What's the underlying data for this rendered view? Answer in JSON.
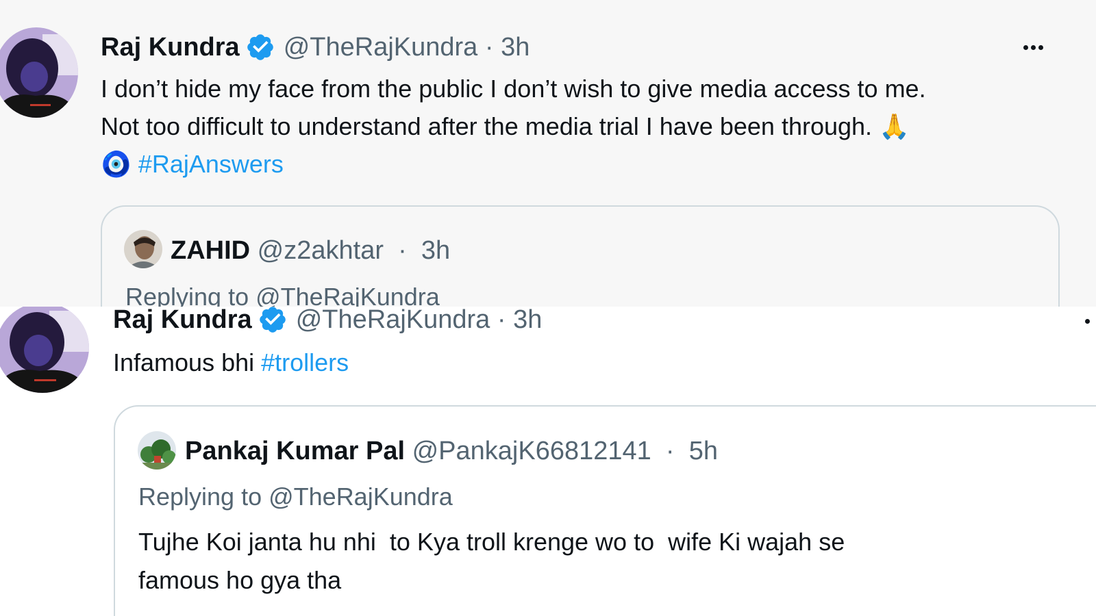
{
  "tweet1": {
    "author_name": "Raj Kundra",
    "handle": "@TheRajKundra",
    "separator": " · ",
    "time": "3h",
    "more_label": "•••",
    "text_line1": "I don’t hide my face from the public I don’t wish to give media access to me.",
    "text_line2": "Not too difficult to understand after the media trial I have been through.",
    "emoji_pray": "🙏",
    "emoji_nazar": "🧿",
    "hashtag": "#RajAnswers",
    "quoted": {
      "author_name": "ZAHID",
      "handle": "@z2akhtar",
      "separator": " · ",
      "time": "3h",
      "replying_prefix": "Replying to ",
      "replying_handle": "@TheRajKundra"
    }
  },
  "tweet2": {
    "author_name": "Raj Kundra",
    "handle": "@TheRajKundra",
    "separator": " · ",
    "time": "3h",
    "text": "Infamous bhi ",
    "hashtag": "#trollers",
    "quoted": {
      "author_name": "Pankaj Kumar Pal",
      "handle": "@PankajK66812141",
      "separator": " · ",
      "time": "5h",
      "replying_prefix": "Replying to ",
      "replying_handle": "@TheRajKundra",
      "text_line1": "Tujhe Koi janta hu nhi  to Kya troll krenge wo to  wife Ki wajah se",
      "text_line2": "famous ho gya tha"
    }
  },
  "colors": {
    "accent": "#1d9bf0",
    "muted": "#536471",
    "text": "#0f1419",
    "border": "#cfd9de",
    "panel1_bg": "#f7f7f7"
  }
}
